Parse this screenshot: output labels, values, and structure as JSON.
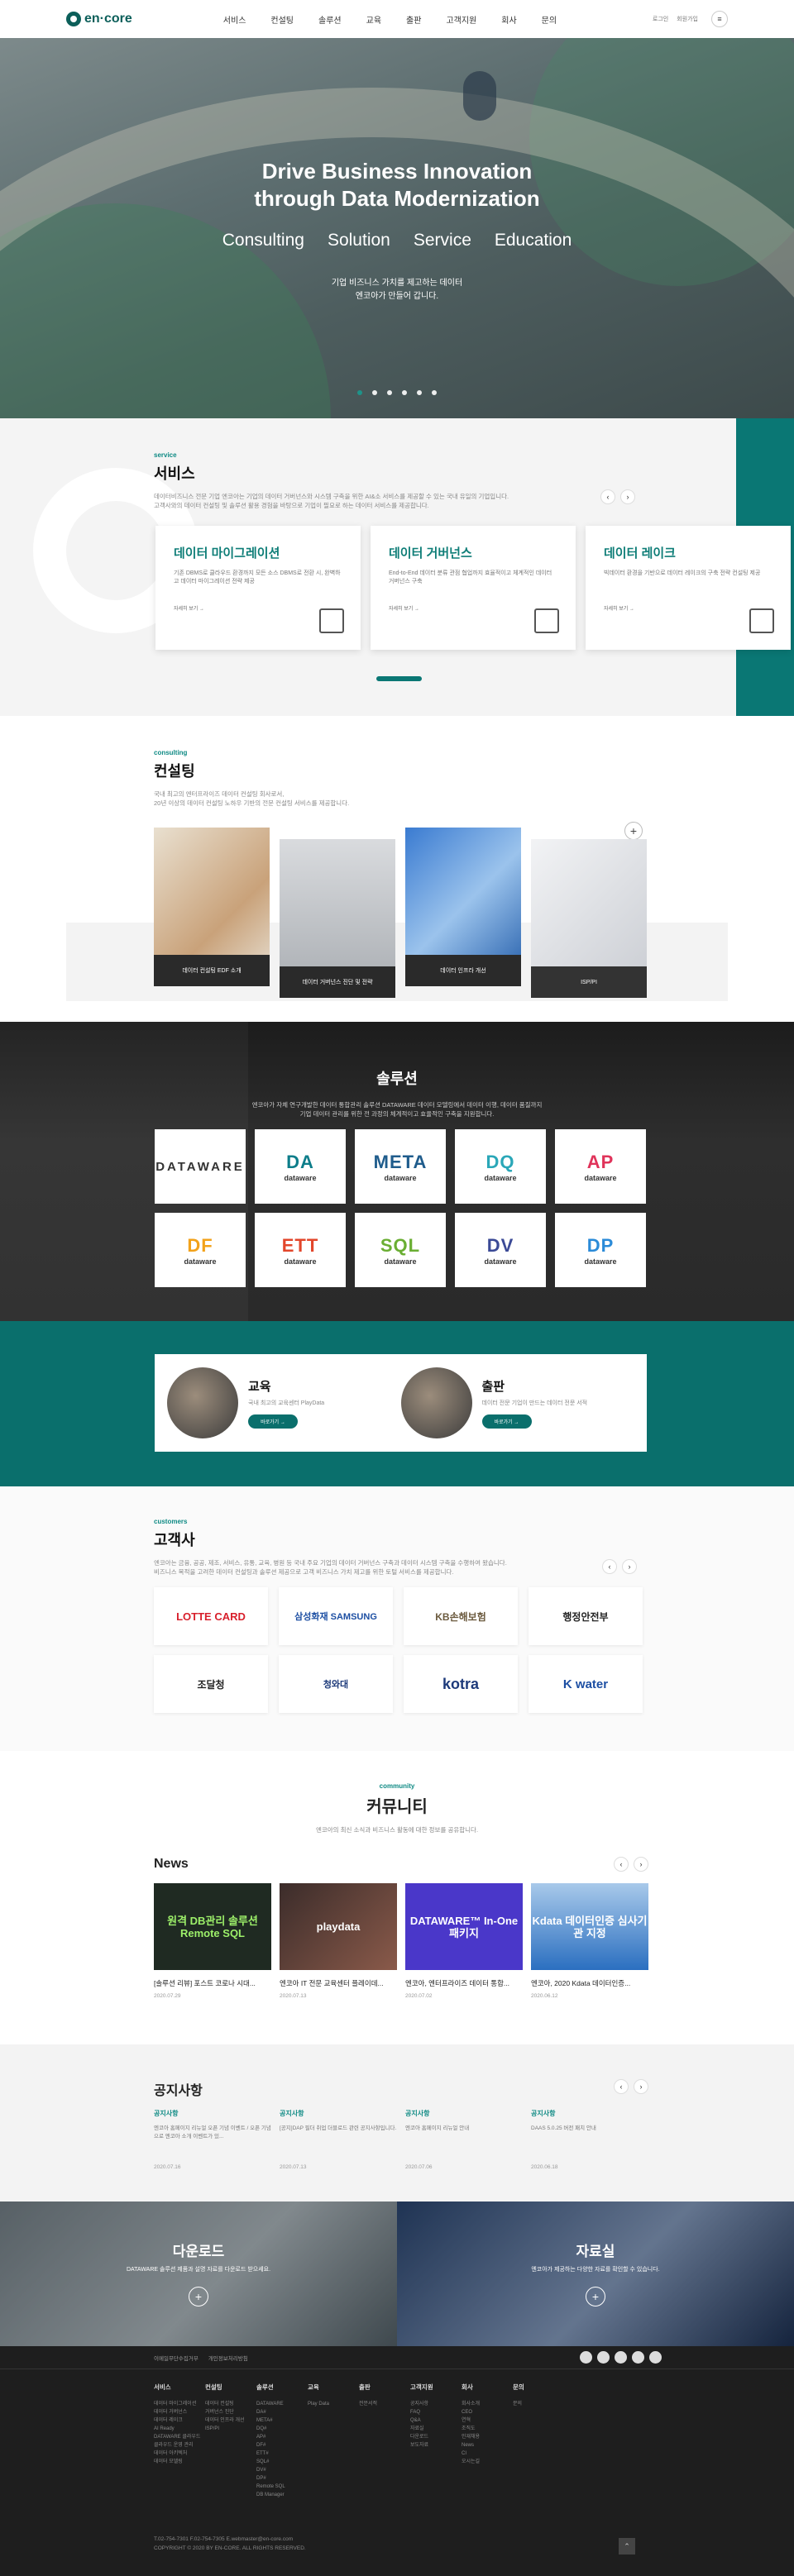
{
  "header": {
    "logo": "en·core",
    "nav": [
      "서비스",
      "컨설팅",
      "솔루션",
      "교육",
      "출판",
      "고객지원",
      "회사",
      "문의"
    ],
    "login": "로그인",
    "join": "회원가입"
  },
  "hero": {
    "title1": "Drive Business Innovation",
    "title2": "through Data Modernization",
    "subs": [
      "Consulting",
      "Solution",
      "Service",
      "Education"
    ],
    "desc1": "기업 비즈니스 가치를 제고하는 데이터",
    "desc2": "엔코아가 만들어 갑니다."
  },
  "service": {
    "eng": "service",
    "kor": "서비스",
    "desc1": "데이터비즈니스 전문 기업 엔코아는 기업의 데이터 거버넌스와 시스템 구축을 위한 AI&소 서비스를 제공할 수 있는 국내 유일의 기업입니다.",
    "desc2": "고객사와의 데이터 컨설팅 및 솔루션 활용 경험을 바탕으로 기업이 필요로 하는 데이터 서비스를 제공합니다.",
    "cards": [
      {
        "title": "데이터 마이그레이션",
        "desc": "기존 DBMS로 클라우드 환경까지 모든 소스 DBMS로 전환 시, 완벽하고 데이터 마이그레이션 전략 제공",
        "more": "자세히 보기 →"
      },
      {
        "title": "데이터 거버넌스",
        "desc": "End-to-End 데이터 분류 관점 협업까지 효율적이고 체계적인 데이터 거버넌스 구축",
        "more": "자세히 보기 →"
      },
      {
        "title": "데이터 레이크",
        "desc": "빅데이터 환경을 기반으로 데이터 레이크의 구축 전략 컨설팅 제공",
        "more": "자세히 보기 →"
      }
    ]
  },
  "consult": {
    "eng": "consulting",
    "kor": "컨설팅",
    "desc1": "국내 최고의 엔터프라이즈 데이터 컨설팅 회사로서,",
    "desc2": "20년 이상의 데이터 컨설팅 노하우 기반의 전문 컨설팅 서비스를 제공합니다.",
    "cards": [
      "데이터 컨설팅 EDF 소개",
      "데이터 거버넌스 진단 및 전략",
      "데이터 인프라 개선",
      "ISP/PI"
    ]
  },
  "solution": {
    "title": "솔루션",
    "desc1": "엔코아가 자체 연구개발한 데이터 통합관리 솔루션 DATAWARE 데이터 모델링에서 데이터 이행, 데이터 품질까지",
    "desc2": "기업 데이터 관리를 위한 전 과정의 체계적이고 효율적인 구축을 지원합니다.",
    "items": [
      {
        "big": "DATAWARE",
        "small": ""
      },
      {
        "big": "DA",
        "small": "dataware"
      },
      {
        "big": "META",
        "small": "dataware"
      },
      {
        "big": "DQ",
        "small": "dataware"
      },
      {
        "big": "AP",
        "small": "dataware"
      },
      {
        "big": "DF",
        "small": "dataware"
      },
      {
        "big": "ETT",
        "small": "dataware"
      },
      {
        "big": "SQL",
        "small": "dataware"
      },
      {
        "big": "DV",
        "small": "dataware"
      },
      {
        "big": "DP",
        "small": "dataware"
      }
    ]
  },
  "edu": {
    "items": [
      {
        "title": "교육",
        "desc": "국내 최고의 교육센터 PlayData",
        "go": "바로가기 →"
      },
      {
        "title": "출판",
        "desc": "데이터 전문 기업이 만드는 데이터 전문 서적",
        "go": "바로가기 →"
      }
    ]
  },
  "customers": {
    "eng": "customers",
    "kor": "고객사",
    "desc1": "엔코아는 금융, 공공, 제조, 서비스, 유통, 교육, 병원 등 국내 주요 기업의 데이터 거버넌스 구축과 데이터 시스템 구축을 수행하여 왔습니다.",
    "desc2": "비즈니스 목적을 고려한 데이터 컨설팅과 솔루션 제공으로 고객 비즈니스 가치 제고를 위한 토털 서비스를 제공합니다.",
    "logos": [
      "LOTTE CARD",
      "삼성화재 SAMSUNG",
      "KB손해보험",
      "행정안전부",
      "조달청",
      "청와대",
      "kotra",
      "K water"
    ]
  },
  "community": {
    "eng": "community",
    "kor": "커뮤니티",
    "desc": "엔코아의 최신 소식과 비즈니스 활동에 대한 정보를 공유합니다.",
    "news_title": "News",
    "news": [
      {
        "img": "원격 DB관리 솔루션 Remote SQL",
        "title": "[솔루션 리뷰] 포스트 코로나 시대...",
        "date": "2020.07.29"
      },
      {
        "img": "playdata",
        "title": "엔코아 IT 전문 교육센터 플레이데...",
        "date": "2020.07.13"
      },
      {
        "img": "DATAWARE™ In-One 패키지",
        "title": "엔코아, 엔터프라이즈 데이터 통합...",
        "date": "2020.07.02"
      },
      {
        "img": "Kdata 데이터인증 심사기관 지정",
        "title": "엔코아, 2020 Kdata 데이터인증...",
        "date": "2020.06.12"
      }
    ]
  },
  "notice": {
    "title": "공지사항",
    "items": [
      {
        "cat": "공지사항",
        "body": "엔코아 홈페이지 리뉴얼 오픈 기념 이벤트 / 오픈 기념으로 엔코아 소개 이벤트가 있...",
        "date": "2020.07.16"
      },
      {
        "cat": "공지사항",
        "body": "[공지]DAP 필더 취업 더블로드 관련 공지사항입니다.",
        "date": "2020.07.13"
      },
      {
        "cat": "공지사항",
        "body": "엔코아 홈페이지 리뉴얼 안내",
        "date": "2020.07.06"
      },
      {
        "cat": "공지사항",
        "body": "DAAS 5.0.25 버전 패치 안내",
        "date": "2020.06.18"
      }
    ]
  },
  "download": {
    "title": "다운로드",
    "desc": "DATAWARE 솔루션 제품과 설명 자료를 다운로드 받으세요.",
    "title2": "자료실",
    "desc2": "엔코아가 제공하는 다양한 자료를 확인할 수 있습니다."
  },
  "footer": {
    "top": [
      "이메일무단수집거부",
      "개인정보처리방침"
    ],
    "cols": [
      {
        "h": "서비스",
        "i": [
          "데이터 마이그레이션",
          "데이터 거버넌스",
          "데이터 레이크",
          "AI Ready",
          "DATAWARE 클라우드",
          "클라우드 운영 관리",
          "데이터 아키텍처",
          "데이터 모델링"
        ]
      },
      {
        "h": "컨설팅",
        "i": [
          "데이터 컨설팅",
          "거버넌스 진단",
          "데이터 인프라 개선",
          "ISP/PI"
        ]
      },
      {
        "h": "솔루션",
        "i": [
          "DATAWARE",
          "DA#",
          "META#",
          "DQ#",
          "AP#",
          "DF#",
          "ETT#",
          "SQL#",
          "DV#",
          "DP#",
          "Remote SQL",
          "DB Manager"
        ]
      },
      {
        "h": "교육",
        "i": [
          "Play Data"
        ]
      },
      {
        "h": "출판",
        "i": [
          "전문서적"
        ]
      },
      {
        "h": "고객지원",
        "i": [
          "공지사항",
          "FAQ",
          "Q&A",
          "자료실",
          "다운로드",
          "보도자료"
        ]
      },
      {
        "h": "회사",
        "i": [
          "회사소개",
          "CEO",
          "연혁",
          "조직도",
          "인재채용",
          "News",
          "CI",
          "오시는길"
        ]
      },
      {
        "h": "문의",
        "i": [
          "문의"
        ]
      }
    ],
    "info1": "T.02-754-7301   F.02-754-7305   E.webmaster@en-core.com",
    "info2": "COPYRIGHT © 2020 BY EN-CORE. ALL RIGHTS RESERVED.",
    "top_btn": "TOP"
  }
}
